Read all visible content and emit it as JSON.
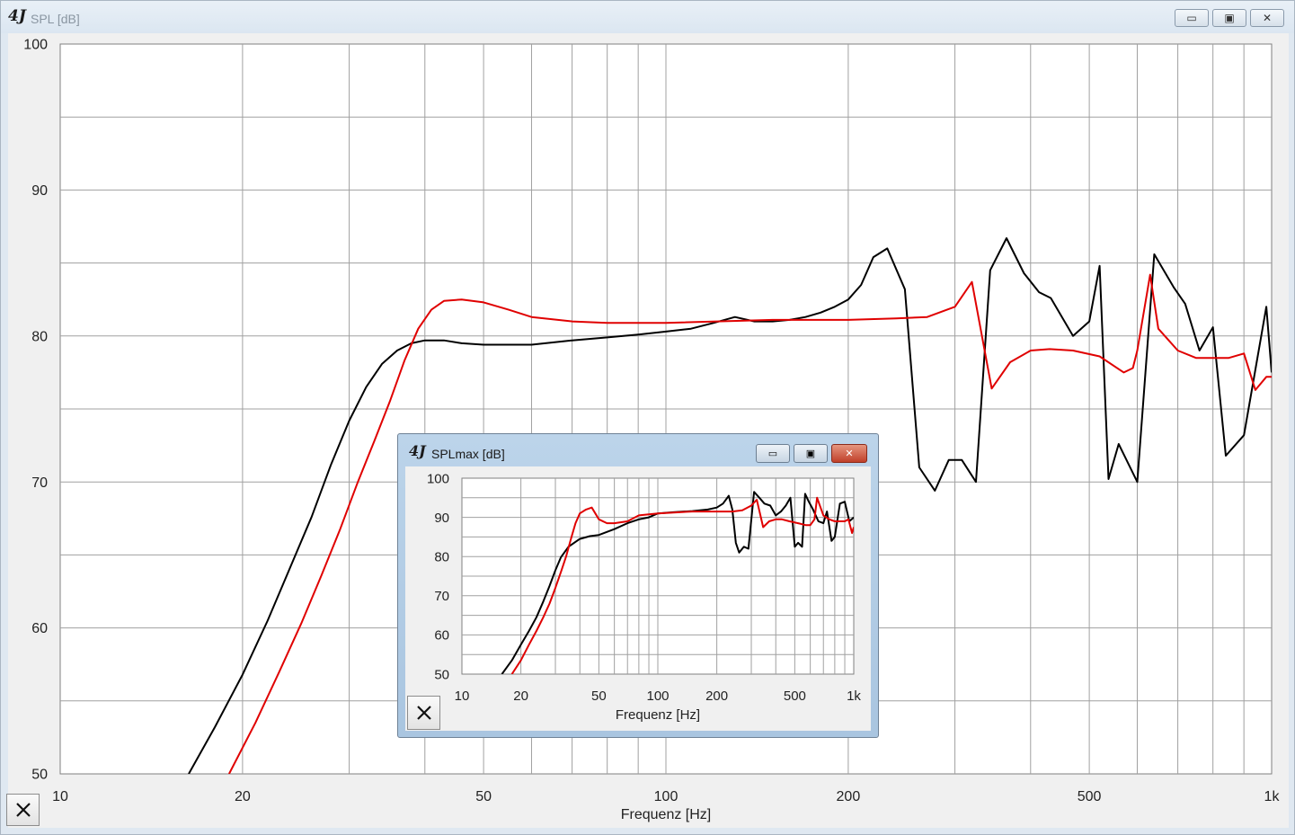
{
  "main_window": {
    "logo": "4J",
    "title": "SPL [dB]",
    "buttons": {
      "minimize": "▭",
      "restore": "▣",
      "close": "✕"
    }
  },
  "inset_window": {
    "logo": "4J",
    "title": "SPLmax [dB]",
    "buttons": {
      "minimize": "▭",
      "restore": "▣",
      "close": "✕"
    }
  },
  "colors": {
    "series_black": "#000000",
    "series_red": "#e00000",
    "grid": "#a0a0a0"
  },
  "icons": {
    "reset_button": "close-x-icon"
  },
  "chart_data": [
    {
      "type": "line",
      "title": "SPL [dB]",
      "xlabel": "Frequenz [Hz]",
      "ylabel": "",
      "xscale": "log",
      "xlim": [
        10,
        1000
      ],
      "ylim": [
        50,
        100
      ],
      "grid": true,
      "xticks": [
        10,
        20,
        50,
        100,
        200,
        500,
        1000
      ],
      "xtick_labels": [
        "10",
        "20",
        "50",
        "100",
        "200",
        "500",
        "1k"
      ],
      "yticks": [
        50,
        60,
        70,
        80,
        90,
        100
      ],
      "ytick_labels": [
        "50",
        "60",
        "70",
        "80",
        "90",
        "100"
      ],
      "series": [
        {
          "color": "#000000",
          "x": [
            16.3,
            18,
            20,
            22,
            24,
            26,
            28,
            30,
            32,
            34,
            36,
            38,
            40,
            43,
            46,
            50,
            55,
            60,
            70,
            80,
            90,
            100,
            110,
            120,
            130,
            140,
            150,
            160,
            170,
            180,
            190,
            200,
            210,
            220,
            232,
            248,
            262,
            278,
            293,
            308,
            325,
            343,
            365,
            390,
            413,
            432,
            470,
            500,
            520,
            538,
            559,
            600,
            640,
            690,
            720,
            760,
            800,
            840,
            900,
            980,
            1000
          ],
          "y": [
            50,
            53.2,
            56.8,
            60.5,
            64.2,
            67.6,
            71.2,
            74.2,
            76.5,
            78.1,
            79.0,
            79.5,
            79.7,
            79.7,
            79.5,
            79.4,
            79.4,
            79.4,
            79.7,
            79.9,
            80.1,
            80.3,
            80.5,
            80.9,
            81.3,
            81.0,
            81.0,
            81.1,
            81.3,
            81.6,
            82.0,
            82.5,
            83.5,
            85.4,
            86.0,
            83.2,
            71.0,
            69.4,
            71.5,
            71.5,
            70.0,
            84.5,
            86.7,
            84.3,
            83.0,
            82.6,
            80.0,
            81.0,
            84.8,
            70.2,
            72.6,
            70.0,
            85.6,
            83.3,
            82.2,
            79.0,
            80.6,
            71.8,
            73.2,
            82.0,
            77.5
          ]
        },
        {
          "color": "#e00000",
          "x": [
            19,
            21,
            23,
            25,
            27,
            29,
            31,
            33,
            35,
            37,
            39,
            41,
            43,
            46,
            50,
            55,
            60,
            70,
            80,
            100,
            150,
            200,
            240,
            270,
            300,
            320,
            345,
            370,
            400,
            430,
            470,
            520,
            570,
            590,
            600,
            630,
            650,
            700,
            750,
            800,
            850,
            900,
            940,
            980,
            1000
          ],
          "y": [
            50,
            53.5,
            57.0,
            60.3,
            63.6,
            66.8,
            70.0,
            72.8,
            75.5,
            78.3,
            80.5,
            81.8,
            82.4,
            82.5,
            82.3,
            81.8,
            81.3,
            81.0,
            80.9,
            80.9,
            81.1,
            81.1,
            81.2,
            81.3,
            82.0,
            83.7,
            76.4,
            78.2,
            79.0,
            79.1,
            79.0,
            78.6,
            77.5,
            77.8,
            79.0,
            84.2,
            80.5,
            79.0,
            78.5,
            78.5,
            78.5,
            78.8,
            76.3,
            77.2,
            77.2
          ]
        }
      ]
    },
    {
      "type": "line",
      "title": "SPLmax [dB]",
      "xlabel": "Frequenz [Hz]",
      "ylabel": "",
      "xscale": "log",
      "xlim": [
        10,
        1000
      ],
      "ylim": [
        50,
        100
      ],
      "grid": true,
      "xticks": [
        10,
        20,
        50,
        100,
        200,
        500,
        1000
      ],
      "xtick_labels": [
        "10",
        "20",
        "50",
        "100",
        "200",
        "500",
        "1k"
      ],
      "yticks": [
        50,
        60,
        70,
        80,
        90,
        100
      ],
      "ytick_labels": [
        "50",
        "60",
        "70",
        "80",
        "90",
        "100"
      ],
      "series": [
        {
          "color": "#000000",
          "x": [
            16,
            18,
            20,
            22,
            24,
            26,
            28,
            30,
            32,
            35,
            40,
            45,
            50,
            60,
            70,
            80,
            90,
            100,
            120,
            150,
            180,
            200,
            215,
            230,
            240,
            250,
            260,
            275,
            290,
            310,
            330,
            350,
            375,
            400,
            425,
            450,
            475,
            500,
            520,
            545,
            565,
            590,
            620,
            660,
            700,
            730,
            770,
            800,
            850,
            900,
            950,
            1000
          ],
          "y": [
            50,
            53.5,
            57.5,
            61,
            64.5,
            68.5,
            72.5,
            76.5,
            79.8,
            82.5,
            84.5,
            85.2,
            85.5,
            87,
            88.5,
            89.5,
            90.0,
            91.0,
            91.3,
            91.6,
            92.0,
            92.5,
            93.5,
            95.5,
            92.0,
            83.5,
            81.0,
            82.5,
            82.0,
            96.5,
            95.0,
            93.5,
            93.0,
            90.5,
            91.5,
            93.0,
            95.0,
            82.5,
            83.5,
            82.5,
            96.0,
            94.0,
            92.0,
            89.0,
            88.5,
            91.5,
            84.0,
            85.0,
            93.5,
            94.0,
            89.0,
            90.0
          ]
        },
        {
          "color": "#e00000",
          "x": [
            18,
            20,
            22,
            24,
            26,
            28,
            30,
            32,
            34,
            36,
            38,
            40,
            43,
            46,
            50,
            55,
            60,
            70,
            80,
            100,
            150,
            200,
            240,
            270,
            300,
            320,
            345,
            370,
            400,
            430,
            470,
            520,
            570,
            600,
            630,
            650,
            700,
            750,
            800,
            850,
            900,
            940,
            980,
            1000
          ],
          "y": [
            50,
            53.5,
            57.5,
            61.0,
            64.5,
            68.0,
            72.0,
            76.0,
            80.0,
            84.5,
            88.5,
            91.0,
            92.0,
            92.5,
            89.5,
            88.5,
            88.5,
            89.0,
            90.5,
            91.0,
            91.5,
            91.5,
            91.5,
            91.8,
            93.0,
            94.5,
            87.5,
            89.0,
            89.5,
            89.5,
            89.0,
            88.5,
            88.0,
            88.0,
            89.5,
            95.0,
            90.5,
            89.5,
            89.0,
            89.0,
            89.0,
            89.5,
            86.0,
            87.5
          ]
        }
      ]
    }
  ]
}
